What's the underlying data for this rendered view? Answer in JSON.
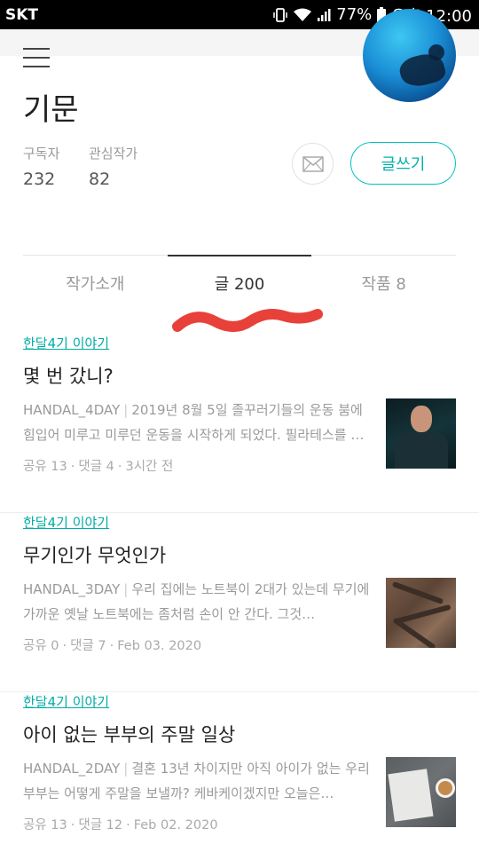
{
  "status": {
    "carrier": "SKT",
    "battery": "77%",
    "time": "오후 12:00"
  },
  "profile": {
    "name": "기문",
    "subscribers_label": "구독자",
    "subscribers": "232",
    "following_label": "관심작가",
    "following": "82",
    "write_label": "글쓰기"
  },
  "tabs": [
    {
      "label": "작가소개"
    },
    {
      "label": "글 200"
    },
    {
      "label": "작품 8"
    }
  ],
  "posts": [
    {
      "tag": "한달4기 이야기",
      "title": "몇 번 갔니?",
      "author": "HANDAL_4DAY",
      "excerpt": "2019년 8월 5일 졸꾸러기들의 운동 붐에 힘입어 미루고 미루던 운동을 시작하게 되었다. 필라테스를 …",
      "shares": "공유 13",
      "comments": "댓글 4",
      "date": "3시간 전"
    },
    {
      "tag": "한달4기 이야기",
      "title": "무기인가 무엇인가",
      "author": "HANDAL_3DAY",
      "excerpt": "우리 집에는 노트북이 2대가 있는데 무기에 가까운 옛날 노트북에는 좀처럼 손이 안 간다. 그것…",
      "shares": "공유 0",
      "comments": "댓글 7",
      "date": "Feb 03. 2020"
    },
    {
      "tag": "한달4기 이야기",
      "title": "아이 없는 부부의 주말 일상",
      "author": "HANDAL_2DAY",
      "excerpt": "결혼 13년 차이지만 아직 아이가 없는 우리 부부는 어떻게 주말을 보낼까? 케바케이겠지만 오늘은…",
      "shares": "공유 13",
      "comments": "댓글 12",
      "date": "Feb 02. 2020"
    }
  ],
  "colors": {
    "accent": "#00b3ad",
    "scribble": "#e8413a"
  }
}
